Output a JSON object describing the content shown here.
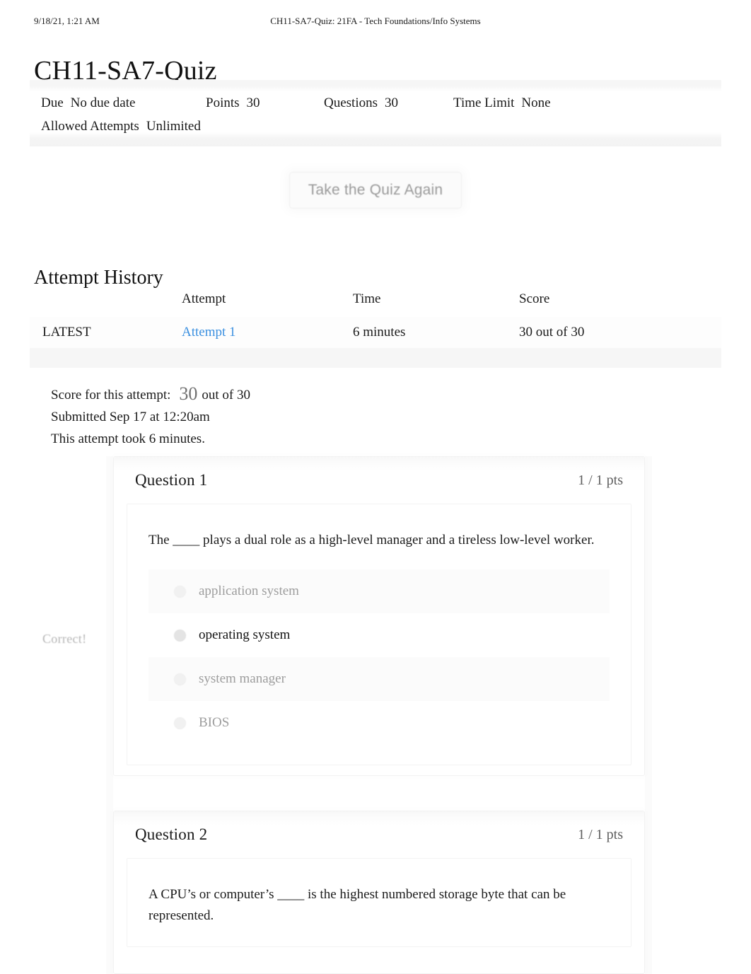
{
  "print_header": {
    "date": "9/18/21, 1:21 AM",
    "document_title": "CH11-SA7-Quiz: 21FA - Tech Foundations/Info Systems"
  },
  "page_title": "CH11-SA7-Quiz",
  "quiz_info": {
    "due_label": "Due",
    "due_value": "No due date",
    "points_label": "Points",
    "points_value": "30",
    "questions_label": "Questions",
    "questions_value": "30",
    "time_limit_label": "Time Limit",
    "time_limit_value": "None",
    "allowed_attempts_label": "Allowed Attempts",
    "allowed_attempts_value": "Unlimited"
  },
  "retake_button": {
    "label": "Take the Quiz Again"
  },
  "attempt_history": {
    "heading": "Attempt History",
    "columns": [
      "",
      "Attempt",
      "Time",
      "Score"
    ],
    "rows": [
      {
        "status": "LATEST",
        "attempt": "Attempt 1",
        "time": "6 minutes",
        "score": "30 out of 30"
      }
    ]
  },
  "score_summary": {
    "score_label": "Score for this attempt:",
    "score_value": "30",
    "score_out_of": "out of 30",
    "submitted": "Submitted Sep 17 at 12:20am",
    "duration": "This attempt took 6 minutes."
  },
  "questions": [
    {
      "name": "Question 1",
      "points": "1 / 1 pts",
      "text": "The ____ plays a dual role as a high-level manager and a tireless low-level worker.",
      "correct_flag": "Correct!",
      "answers": [
        {
          "label": "application system",
          "selected": false
        },
        {
          "label": "operating system",
          "selected": true
        },
        {
          "label": "system manager",
          "selected": false
        },
        {
          "label": "BIOS",
          "selected": false
        }
      ]
    },
    {
      "name": "Question 2",
      "points": "1 / 1 pts",
      "text": "A CPU’s or computer’s ____ is the highest numbered storage byte that can be represented.",
      "correct_flag": "",
      "answers": []
    }
  ],
  "colors": {
    "link_blue": "#3b90e0",
    "muted_gray": "#9d9d9d",
    "text_black": "#1a1a1a",
    "band_gray": "#f6f6f6"
  }
}
